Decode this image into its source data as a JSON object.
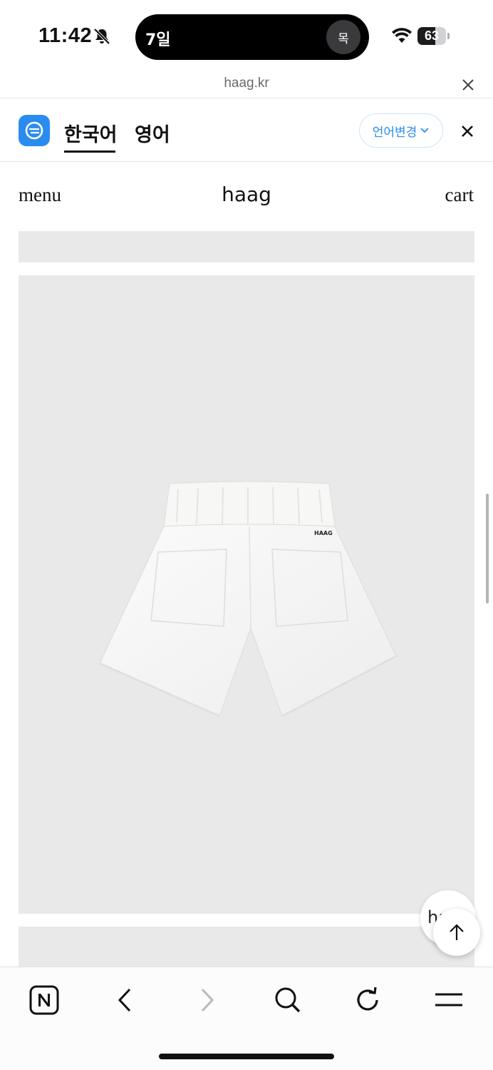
{
  "status_bar": {
    "time": "11:42",
    "island_text": "7일",
    "island_badge": "목",
    "battery_percent": 63,
    "battery_label": "63"
  },
  "browser": {
    "url": "haag.kr"
  },
  "translate_bar": {
    "tabs": [
      {
        "label": "한국어",
        "active": true
      },
      {
        "label": "영어",
        "active": false
      }
    ],
    "change_language_label": "언어변경"
  },
  "site_header": {
    "menu_label": "menu",
    "brand": "haag",
    "cart_label": "cart"
  },
  "product": {
    "garment_print": "HAAG"
  },
  "chat_bubble": {
    "text": "haag"
  },
  "toolbar": {
    "items": [
      "naver-n",
      "back",
      "forward",
      "search",
      "reload",
      "menu"
    ]
  },
  "colors": {
    "accent_blue": "#2b8cf0",
    "placeholder_gray": "#e9e9e9",
    "text": "#111111"
  }
}
